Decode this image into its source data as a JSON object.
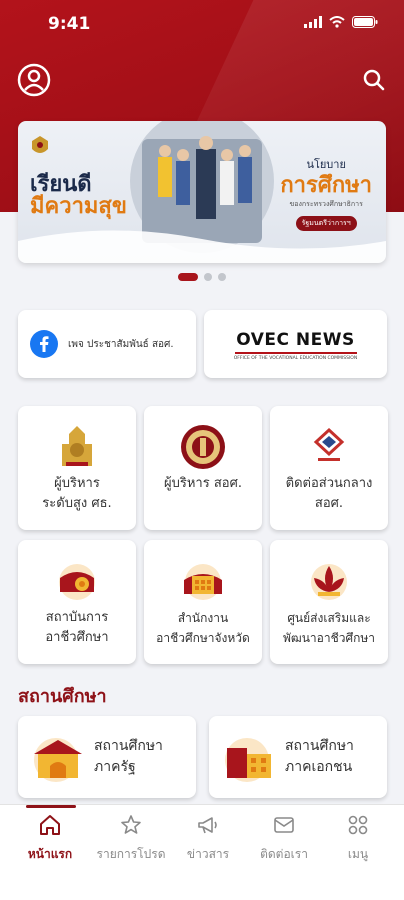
{
  "status_bar": {
    "time": "9:41"
  },
  "banner": {
    "left_line1": "เรียนดี",
    "left_line2": "มีความสุข",
    "right_line1": "นโยบาย",
    "right_line2": "การศึกษา",
    "right_line3": "ของกระทรวงศึกษาธิการ",
    "right_pill": "รัฐมนตรีว่าการฯ"
  },
  "carousel": {
    "total": 3,
    "active_index": 0
  },
  "facebook_card": {
    "label": "เพจ ประชาสัมพันธ์ สอศ."
  },
  "ovec_card": {
    "title": "OVEC NEWS",
    "subtitle": "OFFICE OF THE VOCATIONAL EDUCATION COMMISSION"
  },
  "tiles": [
    {
      "line1": "ผู้บริหาร",
      "line2": "ระดับสูง ศธ."
    },
    {
      "line1": "ผู้บริหาร สอศ.",
      "line2": ""
    },
    {
      "line1": "ติดต่อส่วนกลาง",
      "line2": "สอศ."
    },
    {
      "line1": "สถาบันการ",
      "line2": "อาชีวศึกษา"
    },
    {
      "line1": "สำนักงาน",
      "line2": "อาชีวศึกษาจังหวัด"
    },
    {
      "line1": "ศูนย์ส่งเสริมและ",
      "line2": "พัฒนาอาชีวศึกษา"
    }
  ],
  "section": {
    "title": "สถานศึกษา"
  },
  "schools": [
    {
      "line1": "สถานศึกษา",
      "line2": "ภาครัฐ"
    },
    {
      "line1": "สถานศึกษา",
      "line2": "ภาคเอกชน"
    }
  ],
  "tabs": [
    {
      "label": "หน้าแรก",
      "icon": "home-icon",
      "active": true
    },
    {
      "label": "รายการโปรด",
      "icon": "star-icon",
      "active": false
    },
    {
      "label": "ข่าวสาร",
      "icon": "megaphone-icon",
      "active": false
    },
    {
      "label": "ติดต่อเรา",
      "icon": "mail-icon",
      "active": false
    },
    {
      "label": "เมนู",
      "icon": "grid-icon",
      "active": false
    }
  ],
  "colors": {
    "brand": "#a8151c",
    "accent": "#e07a12",
    "background": "#f2f3f7"
  }
}
